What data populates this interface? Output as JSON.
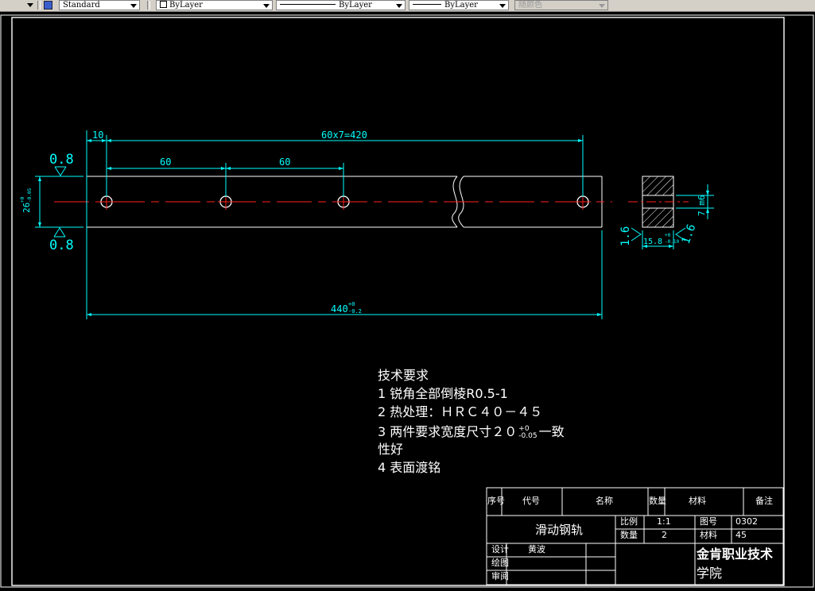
{
  "toolbar": {
    "text_style": "Standard",
    "layer": "ByLayer",
    "linetype": "ByLayer",
    "lineweight": "ByLayer",
    "color": "随颜色"
  },
  "dimensions": {
    "d10": "10",
    "d420": "60x7=420",
    "d60a": "60",
    "d60b": "60",
    "d440": "440",
    "d440_upper": "+0",
    "d440_lower": "-0.2",
    "d26": "26",
    "d26_upper": "+0",
    "d26_lower": "-0.05",
    "rough_top": "0.8",
    "rough_bottom": "0.8",
    "d7m6": "7 m6",
    "d15_8": "15.8",
    "d15_8_upper": "+0",
    "d15_8_lower": "-0.10",
    "rough_left": "1.6",
    "rough_right": "1.6"
  },
  "tech_requirements": {
    "title": "技术要求",
    "item1": "1 锐角全部倒棱R0.5-1",
    "item2": "2 热处理：ＨＲＣ４０－４５",
    "item3a": "3 两件要求宽度尺寸２０",
    "item3_upper": "+0",
    "item3_lower": "-0.05",
    "item3b": "一致",
    "item3c": "性好",
    "item4": "4 表面渡铭"
  },
  "title_block": {
    "h_seq": "序号",
    "h_code": "代号",
    "h_name": "名称",
    "h_qty": "数量",
    "h_material": "材料",
    "h_remark": "备注",
    "part_name": "滑动钢轨",
    "scale_label": "比例",
    "scale_value": "1:1",
    "drawing_no_label": "图号",
    "drawing_no": "0302",
    "qty_label": "数量",
    "qty_value": "2",
    "material_label": "材料",
    "material_value": "45",
    "design_label": "设计",
    "designer": "黄波",
    "drawn_label": "绘图",
    "review_label": "审阅",
    "company_line1": "金肯职业技术",
    "company_line2": "学院"
  }
}
